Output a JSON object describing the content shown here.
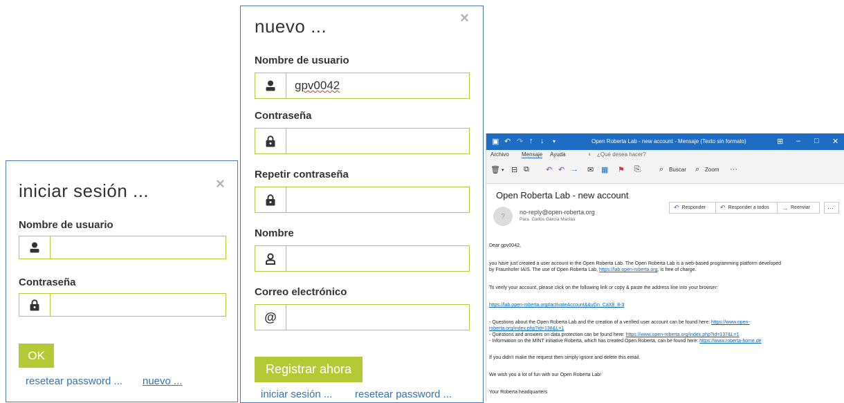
{
  "login": {
    "title": "iniciar sesión ...",
    "close": "×",
    "username_label": "Nombre de usuario",
    "username_value": "",
    "password_label": "Contraseña",
    "password_value": "",
    "ok_label": "OK",
    "reset_link": "resetear password ...",
    "new_link": "nuevo ..."
  },
  "register": {
    "title": "nuevo ...",
    "close": "×",
    "username_label": "Nombre de usuario",
    "username_value": "gpv0042",
    "password_label": "Contraseña",
    "repeat_password_label": "Repetir contraseña",
    "name_label": "Nombre",
    "email_label": "Correo electrónico",
    "submit_label": "Registrar ahora",
    "login_link": "iniciar sesión ...",
    "reset_link": "resetear password ..."
  },
  "outlook": {
    "window_title": "Open Roberta Lab - new account  -  Mensaje (Texto sin formato)",
    "menu": {
      "archivo": "Archivo",
      "mensaje": "Mensaje",
      "ayuda": "Ayuda",
      "search_hint": "¿Qué desea hacer?"
    },
    "ribbon": {
      "buscar": "Buscar",
      "zoom": "Zoom"
    },
    "subject": "Open Roberta Lab - new account",
    "from": "no-reply@open-roberta.org",
    "to_prefix": "Para",
    "to": "Carlos García Macías",
    "actions": {
      "reply": "Responder",
      "reply_all": "Responder a todos",
      "forward": "Reenviar",
      "more": "···"
    },
    "body": {
      "greeting": "Dear gpv0042,",
      "p1a": "you have just created a user account in the Open Roberta Lab. The Open Roberta Lab is a web-based programming platform developed",
      "p1b": "by Fraunhofer IAIS. The use of Open Roberta Lab, ",
      "p1_link": "https://lab.open-roberta.org",
      "p1c": ", is free of charge.",
      "p2": "To verify your account, please click on the following link or copy & paste the address line into your browser:",
      "verify_link": "https://lab.open-roberta.org#activateAccount&&vGn_CaX8_8-3",
      "q1a": "- Questions about the Open Roberta Lab and the creation of a verified user account can be found here: ",
      "q1_link_a": "https://www.open-",
      "q1_link_b": "roberta.org/index.php?id=138&L=1",
      "q2a": "- Questions and answers on data protection can be found here: ",
      "q2_link": "https://www.open-roberta.org/index.php?id=137&L=1",
      "q3a": "- Information on the MINT initiative Roberta, which has created Open Roberta, can be found here: ",
      "q3_link": "https://www.roberta-home.de",
      "p4": "If you didn't make the request then simply ignore and delete this email.",
      "p5": "We wish you a lot of fun with our Open Roberta Lab!",
      "p6": "Your Roberta headquarters"
    }
  },
  "colors": {
    "accent_green": "#b3c935",
    "border_green": "#b3cc3d",
    "link_blue": "#3573b6",
    "outlook_blue": "#1f6cc4"
  }
}
